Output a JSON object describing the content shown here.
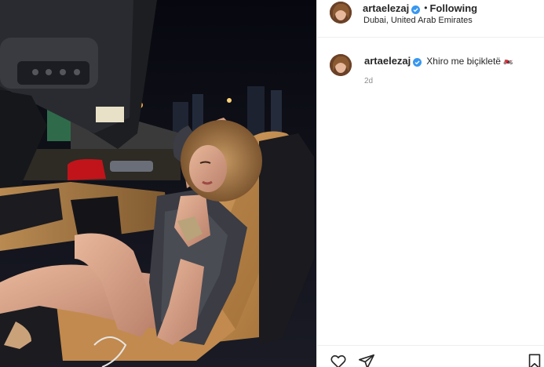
{
  "post": {
    "username": "artaelezaj",
    "verified": true,
    "separator": "•",
    "follow_state": "Following",
    "location": "Dubai, United Arab Emirates",
    "caption_username": "artaelezaj",
    "caption_text": "Xhiro me biçikletë",
    "caption_emoji": "🏍️",
    "timestamp": "2d"
  },
  "icons": {
    "verified_badge": "verified-badge-icon",
    "like": "heart-icon",
    "share": "paper-plane-icon",
    "save": "bookmark-icon"
  },
  "colors": {
    "verified_blue": "#3897f0",
    "seat_tan": "#c08a4b",
    "night_sky": "#0e0f16"
  }
}
